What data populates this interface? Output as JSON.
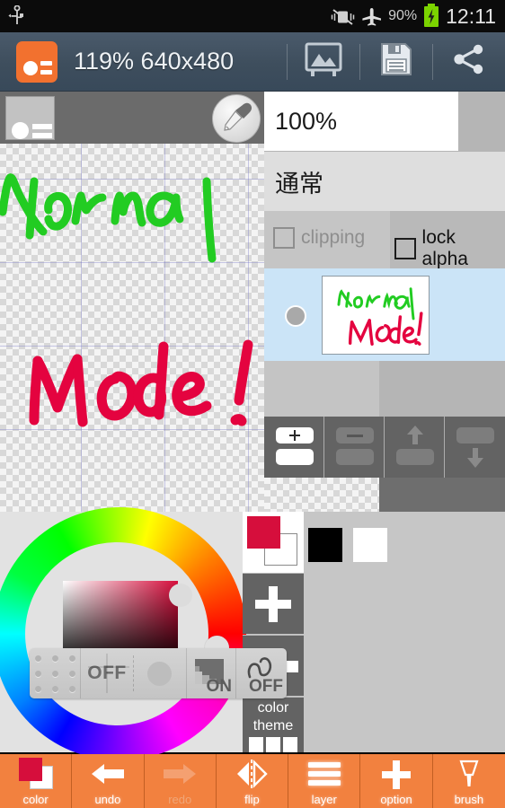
{
  "statusbar": {
    "usb_icon": "usb-icon",
    "vibrate_off_icon": "vibrate-off-icon",
    "airplane_icon": "airplane-mode-icon",
    "battery_percent": "90%",
    "battery_icon": "battery-charging-icon",
    "clock": "12:11"
  },
  "appbar": {
    "logo_icon": "app-logo-icon",
    "title": "119% 640x480",
    "tools": [
      {
        "name": "gallery-icon",
        "label": "gallery"
      },
      {
        "name": "save-icon",
        "label": "save"
      },
      {
        "name": "share-icon",
        "label": "share"
      }
    ]
  },
  "canvas": {
    "layer_badge_icon": "layer-badge-icon",
    "eyedropper_icon": "eyedropper-icon",
    "artwork_line1": "Normal",
    "artwork_line2": "Mode!",
    "artwork_color_line1": "#22cc22",
    "artwork_color_line2": "#e4033f"
  },
  "layer_panel": {
    "opacity": "100%",
    "blend_mode": "通常",
    "clipping_label": "clipping",
    "clipping_checked": false,
    "lock_alpha_label": "lock alpha",
    "lock_alpha_checked": false,
    "layers": [
      {
        "visible": true,
        "selected": true,
        "thumb_line1": "Normal",
        "thumb_line2": "Mode!"
      }
    ],
    "buttons": [
      {
        "name": "add-layer-button",
        "icon": "plus-layer-icon",
        "enabled": true
      },
      {
        "name": "delete-layer-button",
        "icon": "minus-layer-icon",
        "enabled": false
      },
      {
        "name": "move-layer-up-button",
        "icon": "arrow-up-layer-icon",
        "enabled": false
      },
      {
        "name": "move-layer-down-button",
        "icon": "arrow-down-layer-icon",
        "enabled": false
      }
    ]
  },
  "color_picker": {
    "wheel_icon": "hue-wheel",
    "square_icon": "saturation-value-square",
    "current_color": "#d60e3c",
    "swatch_button": "current-color-swatch",
    "add_color_icon": "plus-icon",
    "theme_label_line1": "color",
    "theme_label_line2": "theme",
    "palette": [
      {
        "name": "palette-black",
        "color": "#000000"
      },
      {
        "name": "palette-white",
        "color": "#ffffff"
      }
    ],
    "mini_toolbar": [
      {
        "name": "drag-handle",
        "icon": "dots-grid-icon",
        "label": ""
      },
      {
        "name": "ruler-toggle",
        "icon": "crosshair-icon",
        "label": "OFF"
      },
      {
        "name": "stabilizer-dial",
        "icon": "circle-dial-icon",
        "label": ""
      },
      {
        "name": "gradient-toggle",
        "icon": "gradient-icon",
        "label": "ON"
      },
      {
        "name": "stroke-smoothing-toggle",
        "icon": "squiggle-icon",
        "label": "OFF"
      }
    ]
  },
  "bottom_toolbar": [
    {
      "name": "color-button",
      "label": "color",
      "icon": "two-squares-icon",
      "enabled": true
    },
    {
      "name": "undo-button",
      "label": "undo",
      "icon": "arrow-left-icon",
      "enabled": true
    },
    {
      "name": "redo-button",
      "label": "redo",
      "icon": "arrow-right-icon",
      "enabled": false
    },
    {
      "name": "flip-button",
      "label": "flip",
      "icon": "flip-horizontal-icon",
      "enabled": true
    },
    {
      "name": "layer-button",
      "label": "layer",
      "icon": "stacked-lines-icon",
      "enabled": true
    },
    {
      "name": "option-button",
      "label": "option",
      "icon": "plus-icon",
      "enabled": true
    },
    {
      "name": "brush-button",
      "label": "brush",
      "icon": "brush-icon",
      "enabled": true
    }
  ],
  "colors": {
    "accent_orange": "#f2813f",
    "appbar": "#3e4e5d",
    "panel_grey": "#b5b5b5",
    "layer_selected": "#cbe4f7"
  }
}
